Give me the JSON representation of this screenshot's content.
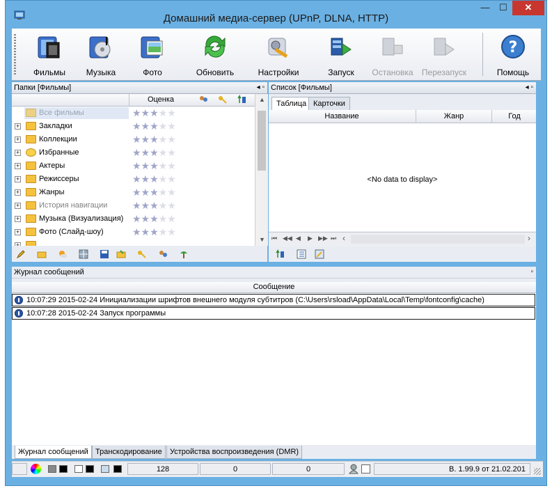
{
  "window": {
    "title": "Домашний медиа-сервер (UPnP, DLNA, HTTP)",
    "minimize_glyph": "—",
    "maximize_glyph": "☐",
    "close_glyph": "✕"
  },
  "toolbar": {
    "buttons": [
      {
        "label": "Фильмы",
        "icon": "film-icon"
      },
      {
        "label": "Музыка",
        "icon": "music-icon"
      },
      {
        "label": "Фото",
        "icon": "photo-icon"
      },
      {
        "label": "Обновить",
        "icon": "refresh-icon"
      },
      {
        "label": "Настройки",
        "icon": "settings-icon"
      },
      {
        "label": "Запуск",
        "icon": "start-icon"
      },
      {
        "label": "Остановка",
        "icon": "stop-icon",
        "disabled": true
      },
      {
        "label": "Перезапуск",
        "icon": "restart-icon",
        "disabled": true
      },
      {
        "label": "Помощь",
        "icon": "help-icon"
      }
    ]
  },
  "folders": {
    "header": "Папки [Фильмы]",
    "pin_glyph": "◂ ▫",
    "rating_column": "Оценка",
    "items": [
      {
        "label": "Все фильмы",
        "rating": 3,
        "selected": true
      },
      {
        "label": "Закладки",
        "rating": 3
      },
      {
        "label": "Коллекции",
        "rating": 3
      },
      {
        "label": "Избранные",
        "rating": 3
      },
      {
        "label": "Актеры",
        "rating": 3
      },
      {
        "label": "Режиссеры",
        "rating": 3
      },
      {
        "label": "Жанры",
        "rating": 3
      },
      {
        "label": "История навигации",
        "rating": 3,
        "muted": true
      },
      {
        "label": "Музыка (Визуализация)",
        "rating": 3
      },
      {
        "label": "Фото (Слайд-шоу)",
        "rating": 3
      }
    ]
  },
  "list": {
    "header": "Список [Фильмы]",
    "tabs": [
      "Таблица",
      "Карточки"
    ],
    "columns": [
      "Название",
      "Жанр",
      "Год"
    ],
    "empty_text": "<No data to display>"
  },
  "log": {
    "header": "Журнал сообщений",
    "column": "Сообщение",
    "rows": [
      "10:07:29 2015-02-24 Инициализации шрифтов внешнего модуля субтитров (C:\\Users\\rsload\\AppData\\Local\\Temp\\fontconfig\\cache)",
      "10:07:28 2015-02-24 Запуск программы"
    ],
    "tabs": [
      "Журнал сообщений",
      "Транскодирование",
      "Устройства воспроизведения (DMR)"
    ]
  },
  "status": {
    "count1": "128",
    "count2": "0",
    "count3": "0",
    "version": "В. 1.99.9 от 21.02.201"
  }
}
